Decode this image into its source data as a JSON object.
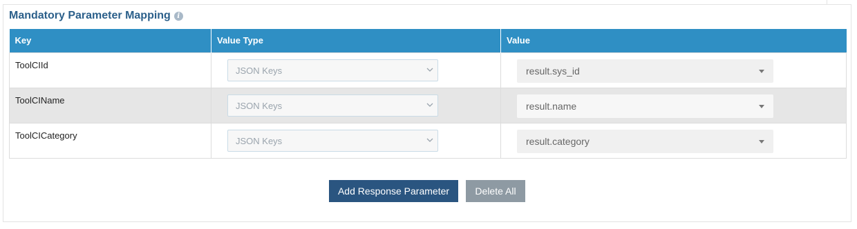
{
  "section": {
    "title": "Mandatory Parameter Mapping",
    "info_icon": "info-icon"
  },
  "table": {
    "headers": [
      "Key",
      "Value Type",
      "Value"
    ],
    "rows": [
      {
        "key": "ToolCIId",
        "value_type": "JSON Keys",
        "value": "result.sys_id"
      },
      {
        "key": "ToolCIName",
        "value_type": "JSON Keys",
        "value": "result.name"
      },
      {
        "key": "ToolCICategory",
        "value_type": "JSON Keys",
        "value": "result.category"
      }
    ]
  },
  "buttons": {
    "add_label": "Add Response Parameter",
    "delete_label": "Delete All"
  },
  "colors": {
    "header_bg": "#2f8fc4",
    "title": "#2b5f8a",
    "add_button": "#2a5580",
    "delete_button": "#8e9aa3",
    "alt_row": "#e6e6e6"
  }
}
